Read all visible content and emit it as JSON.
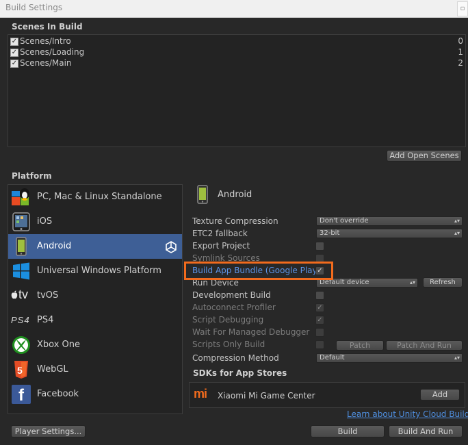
{
  "window": {
    "title": "Build Settings",
    "close_glyph": "▫"
  },
  "scenes": {
    "heading": "Scenes In Build",
    "items": [
      {
        "name": "Scenes/Intro",
        "index": "0",
        "checked": true
      },
      {
        "name": "Scenes/Loading",
        "index": "1",
        "checked": true
      },
      {
        "name": "Scenes/Main",
        "index": "2",
        "checked": true
      }
    ],
    "add_open_scenes": "Add Open Scenes"
  },
  "platform": {
    "heading": "Platform",
    "items": [
      {
        "label": "PC, Mac & Linux Standalone",
        "icon": "pc-mac-linux-icon"
      },
      {
        "label": "iOS",
        "icon": "ios-device-icon"
      },
      {
        "label": "Android",
        "icon": "android-phone-icon",
        "selected": true
      },
      {
        "label": "Universal Windows Platform",
        "icon": "windows-logo-icon"
      },
      {
        "label": "tvOS",
        "icon": "apple-tv-icon",
        "icon_text": "tv"
      },
      {
        "label": "PS4",
        "icon": "ps4-logo-icon",
        "icon_text": "PS4"
      },
      {
        "label": "Xbox One",
        "icon": "xbox-logo-icon"
      },
      {
        "label": "WebGL",
        "icon": "html5-icon",
        "icon_text": "5"
      },
      {
        "label": "Facebook",
        "icon": "facebook-icon",
        "icon_text": "f"
      }
    ]
  },
  "settings": {
    "platform_title": "Android",
    "texture_compression": {
      "label": "Texture Compression",
      "value": "Don't override"
    },
    "etc2_fallback": {
      "label": "ETC2 fallback",
      "value": "32-bit"
    },
    "export_project": {
      "label": "Export Project",
      "checked": false
    },
    "symlink_sources": {
      "label": "Symlink Sources",
      "checked": false
    },
    "build_app_bundle": {
      "label": "Build App Bundle (Google Play)",
      "checked": true
    },
    "run_device": {
      "label": "Run Device",
      "value": "Default device",
      "refresh": "Refresh"
    },
    "development_build": {
      "label": "Development Build",
      "checked": false
    },
    "autoconnect_profiler": {
      "label": "Autoconnect Profiler",
      "checked": true
    },
    "script_debugging": {
      "label": "Script Debugging",
      "checked": true
    },
    "wait_managed_debugger": {
      "label": "Wait For Managed Debugger",
      "checked": false
    },
    "scripts_only_build": {
      "label": "Scripts Only Build",
      "checked": false,
      "patch": "Patch",
      "patch_and_run": "Patch And Run"
    },
    "compression_method": {
      "label": "Compression Method",
      "value": "Default"
    },
    "check_glyph": "✓",
    "dropdown_arrow": "▴▾"
  },
  "sdks": {
    "heading": "SDKs for App Stores",
    "items": [
      {
        "name": "Xiaomi Mi Game Center",
        "add": "Add",
        "logo_text": "mi"
      }
    ],
    "cloud_link": "Learn about Unity Cloud Build"
  },
  "footer": {
    "player_settings": "Player Settings...",
    "build": "Build",
    "build_and_run": "Build And Run"
  },
  "colors": {
    "selected_row": "#3e5f96",
    "highlight": "#f26b1d",
    "link": "#4f8fe0"
  }
}
